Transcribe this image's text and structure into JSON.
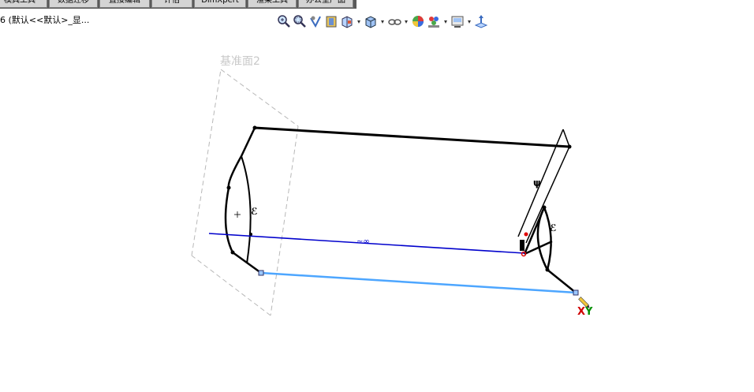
{
  "tabs": [
    {
      "label": "模具工具"
    },
    {
      "label": "数据迁移"
    },
    {
      "label": "直接编辑"
    },
    {
      "label": "评估"
    },
    {
      "label": "DimXpert"
    },
    {
      "label": "渲染工具"
    },
    {
      "label": "办公室产品"
    }
  ],
  "document": {
    "title": "6 (默认<<默认>_显..."
  },
  "view_toolbar": {
    "icons": [
      "zoom-to-fit-icon",
      "zoom-to-area-icon",
      "previous-view-icon",
      "section-view-icon",
      "view-orientation-icon",
      "display-style-icon",
      "hide-show-items-icon",
      "edit-appearance-icon",
      "apply-scene-icon",
      "view-settings-icon",
      "normal-to-icon"
    ]
  },
  "viewport": {
    "plane_label": "基准面2",
    "triad": {
      "x": "X",
      "y": "Y"
    },
    "colors": {
      "sketch": "#000000",
      "selected": "#0000cc",
      "highlight": "#4da6ff",
      "plane": "#b0b0b0"
    }
  }
}
